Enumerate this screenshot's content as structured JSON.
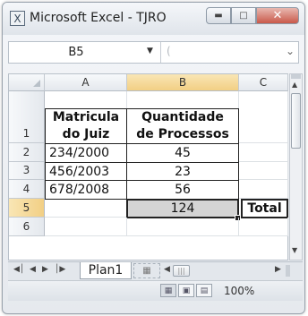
{
  "window": {
    "title": "Microsoft Excel - TJRO",
    "app_icon": "excel-icon",
    "buttons": {
      "minimize": "minimize-icon",
      "maximize": "maximize-icon",
      "close": "close-icon"
    }
  },
  "formula_bar": {
    "name_box": "B5",
    "formula": ""
  },
  "grid": {
    "columns": [
      "A",
      "B",
      "C"
    ],
    "rows": [
      "1",
      "2",
      "3",
      "4",
      "5",
      "6"
    ],
    "selected_column": "B",
    "selected_row": "5",
    "cells": {
      "A1": "Matricula do Juiz",
      "B1": "Quantidade de Processos",
      "A2": "234/2000",
      "B2": "45",
      "A3": "456/2003",
      "B3": "23",
      "A4": "678/2008",
      "B4": "56",
      "B5": "124",
      "C5": "Total"
    },
    "header_lines": {
      "A1_line1": "Matricula",
      "A1_line2": "do Juiz",
      "B1_line1": "Quantidade",
      "B1_line2": "de Processos"
    }
  },
  "sheet_tabs": {
    "active": "Plan1"
  },
  "status_bar": {
    "zoom": "100%"
  },
  "colors": {
    "selection_header": "#f2cf84",
    "sum_cell_fill": "#d4d4d4",
    "close_button": "#c9594a"
  }
}
